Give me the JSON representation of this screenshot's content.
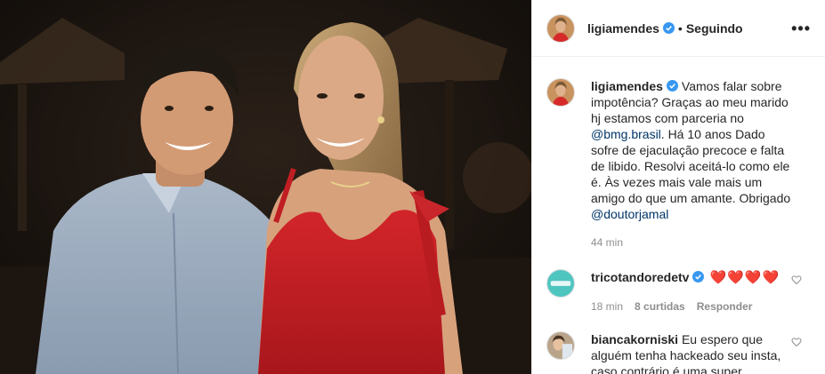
{
  "post": {
    "username": "ligiamendes",
    "separator": "•",
    "follow_status": "Seguindo",
    "more_label": "•••"
  },
  "caption": {
    "username": "ligiamendes",
    "text_1": "Vamos falar sobre impotência? Graças ao meu marido hj estamos com parceria no ",
    "mention_1": "@bmg.brasil",
    "text_2": ". Há 10 anos Dado sofre de ejaculação precoce e falta de libido. Resolvi aceitá-lo como ele é. Às vezes mais vale mais um amigo do que um amante. Obrigado ",
    "mention_2": "@doutorjamal",
    "time": "44 min"
  },
  "comments": [
    {
      "username": "tricotandoredetv",
      "text": "❤️❤️❤️❤️",
      "time": "18 min",
      "likes": "8 curtidas",
      "reply": "Responder"
    },
    {
      "username": "biancakorniski",
      "text": "Eu espero que alguém tenha hackeado seu insta, caso contrário é uma super"
    }
  ],
  "icons": {
    "verified": "verified-badge-icon",
    "like": "heart-outline-icon",
    "more": "more-options-icon"
  },
  "colors": {
    "verified_blue": "#3897f0",
    "mention_blue": "#003569",
    "muted": "#8e8e8e",
    "heart_red": "#ed4956"
  }
}
